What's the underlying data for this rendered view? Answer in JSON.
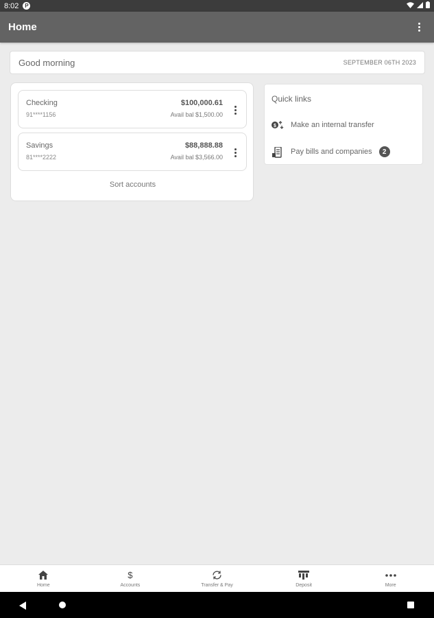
{
  "status_bar": {
    "time": "8:02"
  },
  "app_bar": {
    "title": "Home"
  },
  "greeting": {
    "text": "Good morning",
    "date": "SEPTEMBER 06TH 2023"
  },
  "accounts": {
    "items": [
      {
        "name": "Checking",
        "number": "91****1156",
        "balance": "$100,000.61",
        "available": "Avail bal $1,500.00"
      },
      {
        "name": "Savings",
        "number": "81****2222",
        "balance": "$88,888.88",
        "available": "Avail bal $3,566.00"
      }
    ],
    "sort_label": "Sort accounts"
  },
  "quick_links": {
    "title": "Quick links",
    "items": [
      {
        "label": "Make an internal transfer",
        "icon": "transfer-icon"
      },
      {
        "label": "Pay bills and companies",
        "icon": "bill-icon",
        "badge": "2"
      }
    ]
  },
  "bottom_nav": {
    "items": [
      {
        "label": "Home",
        "icon": "home-icon"
      },
      {
        "label": "Accounts",
        "icon": "dollar-icon"
      },
      {
        "label": "Transfer & Pay",
        "icon": "transfer-pay-icon"
      },
      {
        "label": "Deposit",
        "icon": "deposit-icon"
      },
      {
        "label": "More",
        "icon": "more-icon"
      }
    ]
  },
  "colors": {
    "app_bar": "#636363",
    "background": "#ececec",
    "status_bar": "#3c3c3c"
  }
}
